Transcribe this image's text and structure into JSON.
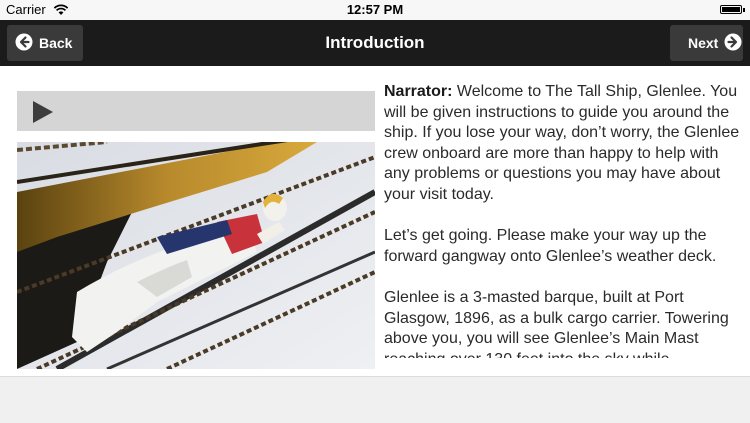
{
  "status_bar": {
    "carrier": "Carrier",
    "time": "12:57 PM",
    "battery_level": 1.0
  },
  "navbar": {
    "title": "Introduction",
    "back_label": "Back",
    "next_label": "Next",
    "back_icon": "arrow-left-icon",
    "next_icon": "arrow-right-icon"
  },
  "audio": {
    "icon": "play-icon"
  },
  "image": {
    "description_name": "ship-figurehead-photo"
  },
  "narration": {
    "speaker": "Narrator:",
    "paragraph1_text": " Welcome to The Tall Ship, Glenlee. You will be given instructions to guide you around the ship. If you lose your way, don’t worry, the Glenlee crew onboard are more than happy to help with any problems or questions you may have about your visit today.",
    "paragraph2": "Let’s get going. Please make your way up the forward gangway onto Glenlee’s weather deck.",
    "paragraph3": "Glenlee is a 3-masted barque, built at Port Glasgow, 1896, as a bulk cargo carrier. Towering above you, you will see Glenlee’s Main Mast reaching over 130 feet into the sky while"
  },
  "colors": {
    "navbar": "#1b1b1b",
    "nav_button": "#3a3a3a",
    "audio_bar": "#d5d5d5",
    "text": "#2a2a2a"
  }
}
